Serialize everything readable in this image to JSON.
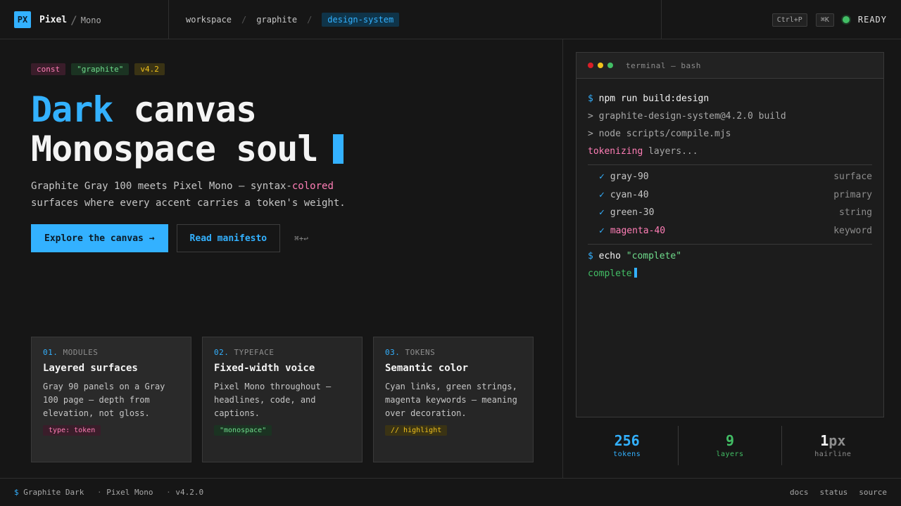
{
  "colors": {
    "accent": "#33b1ff",
    "magenta": "#ff7eb6",
    "green": "#42be65",
    "yellow": "#f1c21b",
    "page": "#161616",
    "panel": "#262626"
  },
  "brand": {
    "logo": "PX",
    "name": "Pixel",
    "separator": "/",
    "sub": "Mono"
  },
  "breadcrumbs": [
    {
      "label": "workspace"
    },
    {
      "label": "graphite"
    },
    {
      "label": "design-system",
      "active": true
    }
  ],
  "breadcrumb_sep": "/",
  "topbar": {
    "shortcut_palette": "Ctrl+P",
    "shortcut_search": "⌘K",
    "status": "READY"
  },
  "hero": {
    "tags": [
      "const",
      "\"graphite\"",
      "v4.2"
    ],
    "title_accent": "Dark",
    "title_rest": " canvas",
    "title_line2": "Monospace soul",
    "lead_before": "Graphite Gray 100 meets Pixel Mono — syntax-",
    "lead_highlight": "colored",
    "lead_after": "surfaces where every accent carries a token's weight.",
    "primary_cta": "Explore the canvas →",
    "secondary_cta": "Read manifesto",
    "shortcut_hint": "⌘+↩"
  },
  "cards": [
    {
      "num": "01.",
      "eyebrow": "MODULES",
      "title": "Layered surfaces",
      "body": "Gray 90 panels on a Gray 100 page — depth from elevation, not gloss.",
      "pill": "type: token",
      "pill_style": "magenta"
    },
    {
      "num": "02.",
      "eyebrow": "TYPEFACE",
      "title": "Fixed-width voice",
      "body": "Pixel Mono throughout — headlines, code, and captions.",
      "pill": "\"monospace\"",
      "pill_style": "green"
    },
    {
      "num": "03.",
      "eyebrow": "TOKENS",
      "title": "Semantic color",
      "body": "Cyan links, green strings, magenta keywords — meaning over decoration.",
      "pill": "// highlight",
      "pill_style": "yellow"
    }
  ],
  "terminal": {
    "title": "terminal — bash",
    "prompt": "$",
    "cmd1": "npm run build:design",
    "out1": "> graphite-design-system@4.2.0 build",
    "out2": "> node scripts/compile.mjs",
    "tokenizing_keyword": "tokenizing",
    "tokenizing_rest": " layers...",
    "check": "✓",
    "tokens": [
      {
        "name": "gray-90",
        "role": "surface",
        "style": "default"
      },
      {
        "name": "cyan-40",
        "role": "primary",
        "style": "default"
      },
      {
        "name": "green-30",
        "role": "string",
        "style": "default"
      },
      {
        "name": "magenta-40",
        "role": "keyword",
        "style": "magenta"
      }
    ],
    "cmd2_word": "echo",
    "cmd2_string": " \"complete\"",
    "result": "complete"
  },
  "stats": [
    {
      "value": "256",
      "unit": "",
      "label": "tokens",
      "color": "#33b1ff"
    },
    {
      "value": "9",
      "unit": "",
      "label": "layers",
      "color": "#42be65"
    },
    {
      "value": "1",
      "unit": "px",
      "label": "hairline",
      "color": "#f4f4f4"
    }
  ],
  "footer": {
    "prompt": "$",
    "theme": "Graphite Dark",
    "font": "Pixel Mono",
    "version": "v4.2.0",
    "sep": "·",
    "links": [
      "docs",
      "status",
      "source"
    ]
  }
}
